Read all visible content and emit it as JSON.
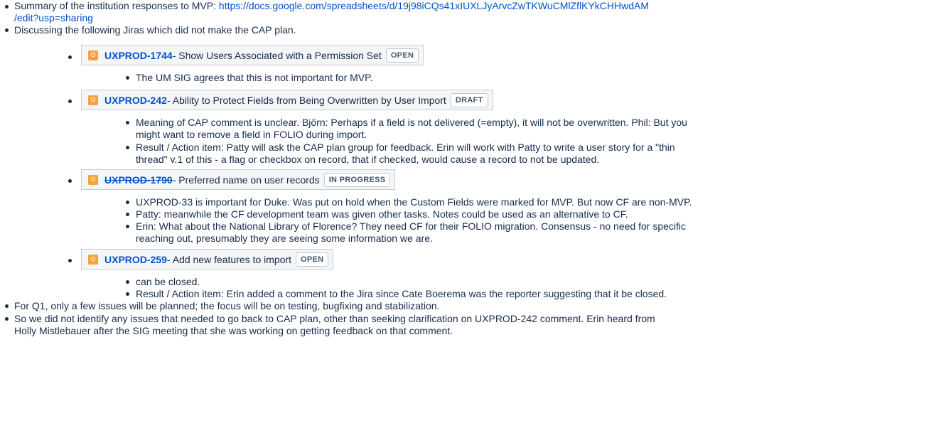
{
  "summary": {
    "prefix": "Summary of the institution responses to MVP: ",
    "link_line1": "https://docs.google.com/spreadsheets/d/19j98iCQs41xIUXLJyArvcZwTKWuCMlZflKYkCHHwdAM",
    "link_line2": "/edit?usp=sharing"
  },
  "discussing": "Discussing the following Jiras which did not make the CAP plan.",
  "jiras": [
    {
      "key": "UXPROD-1744",
      "summary": " - Show Users Associated with a Permission Set",
      "status": "OPEN",
      "notes": [
        "The UM SIG agrees that this is not important for MVP."
      ]
    },
    {
      "key": "UXPROD-242",
      "summary": " - Ability to Protect Fields from Being Overwritten by User Import",
      "status": "DRAFT",
      "notes": [
        "Meaning of CAP comment is unclear. Björn: Perhaps if a field is not delivered (=empty), it will not be overwritten. Phil: But you",
        "might want to remove a field in FOLIO during import.",
        "Result / Action item: Patty will ask the CAP plan group for feedback. Erin will work with Patty to write a user story for a \"thin",
        "thread\" v.1 of this - a flag or checkbox on record, that if checked, would cause a record to not be updated."
      ]
    },
    {
      "key": "UXPROD-1790",
      "summary": " - Preferred name on user records",
      "status": "IN PROGRESS",
      "notes": [
        "UXPROD-33 is important for Duke. Was put on hold when the Custom Fields were marked for MVP. But now CF are non-MVP.",
        "Patty: meanwhile the CF development team was given other tasks. Notes could be used as an alternative to CF.",
        "Erin: What about the National Library of Florence? They need CF for their FOLIO migration. Consensus - no need for specific",
        "reaching out, presumably they are seeing some information we are."
      ]
    },
    {
      "key": "UXPROD-259",
      "summary": " - Add new features to import",
      "status": "OPEN",
      "notes": [
        "can be closed.",
        "Result / Action item: Erin added a comment to the Jira since Cate Boerema was the reporter suggesting that it be closed."
      ]
    }
  ],
  "q1": "For Q1, only a few issues will be planned; the focus will be on testing, bugfixing and stabilization.",
  "conclusion": {
    "line1": "So we did not identify any issues that needed to go back to CAP plan, other than seeking clarification on UXPROD-242 comment. Erin heard from",
    "line2": "Holly Mistlebauer after the SIG meeting that she was working on getting feedback on that comment."
  },
  "colors": {
    "link": "#0052cc",
    "text": "#172b4d",
    "jira_icon": "#f6a23a",
    "panel_bg": "#f4f5f7"
  }
}
